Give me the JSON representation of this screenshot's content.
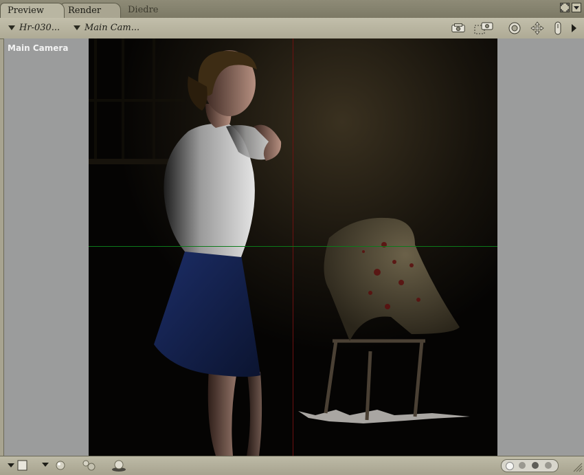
{
  "tabs": [
    {
      "label": "Preview"
    },
    {
      "label": "Render"
    },
    {
      "label": "Diedre"
    }
  ],
  "toolbar": {
    "figure_menu": "Hr-030...",
    "camera_menu": "Main Cam..."
  },
  "viewport": {
    "camera_label": "Main Camera"
  },
  "icons": {
    "window_controls": [
      "expand-icon",
      "menu-icon"
    ],
    "toolbar": [
      "render-icon",
      "area-render-icon",
      "rotate-icon",
      "move-icon",
      "hand-icon",
      "more-icon"
    ],
    "bottom": [
      "display-style-icon",
      "lighting-icon",
      "shadow-icon",
      "ground-icon",
      "dot-page-icon"
    ]
  },
  "colors": {
    "guide_vertical": "#6e1010",
    "guide_horizontal": "#0c7a1a"
  }
}
